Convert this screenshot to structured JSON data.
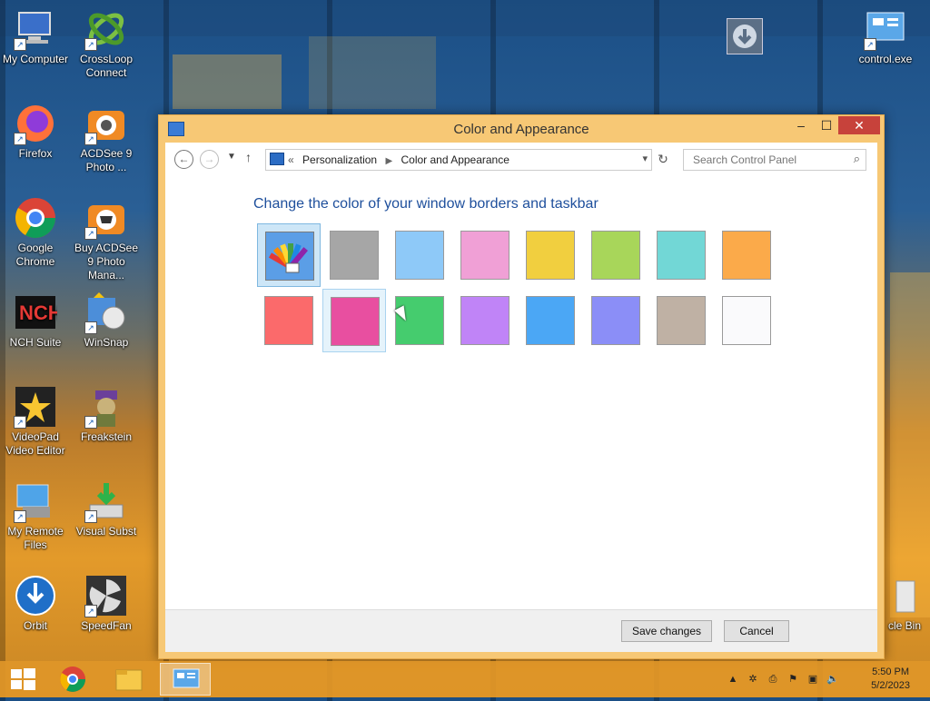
{
  "desktop": {
    "icons": [
      {
        "label": "My Computer",
        "icon": "computer-icon"
      },
      {
        "label": "CrossLoop Connect",
        "icon": "crossloop-icon"
      },
      {
        "label": "Firefox",
        "icon": "firefox-icon"
      },
      {
        "label": "ACDSee 9 Photo ...",
        "icon": "acdsee-icon"
      },
      {
        "label": "Google Chrome",
        "icon": "chrome-icon"
      },
      {
        "label": "Buy ACDSee 9 Photo Mana...",
        "icon": "acdsee-buy-icon"
      },
      {
        "label": "NCH Suite",
        "icon": "nch-icon"
      },
      {
        "label": "WinSnap",
        "icon": "winsnap-icon"
      },
      {
        "label": "VideoPad Video Editor",
        "icon": "videopad-icon"
      },
      {
        "label": "Freakstein",
        "icon": "freakstein-icon"
      },
      {
        "label": "My Remote Files",
        "icon": "remote-files-icon"
      },
      {
        "label": "Visual Subst",
        "icon": "visual-subst-icon"
      },
      {
        "label": "Orbit",
        "icon": "orbit-icon"
      },
      {
        "label": "SpeedFan",
        "icon": "speedfan-icon"
      },
      {
        "label": "control.exe",
        "icon": "control-panel-icon"
      },
      {
        "label": "cle Bin",
        "icon": "recycle-bin-icon"
      }
    ]
  },
  "window": {
    "title": "Color and Appearance",
    "controls": {
      "minimize": "–",
      "maximize": "☐",
      "close": "✕"
    }
  },
  "navigation": {
    "back": "←",
    "forward": "→",
    "up": "↑",
    "refresh": "↻",
    "crumb_prefix": "«",
    "breadcrumbs": [
      "Personalization",
      "Color and Appearance"
    ],
    "search_placeholder": "Search Control Panel"
  },
  "content": {
    "heading": "Change the color of your window borders and taskbar",
    "swatches_row1": [
      "#automatic",
      "#a6a6a6",
      "#8ec9f8",
      "#f0a0d6",
      "#f1cf3f",
      "#a8d65a",
      "#72d7d6",
      "#fbaa4a"
    ],
    "swatches_row2": [
      "#fb6a6b",
      "#e84fa0",
      "#45cc6e",
      "#c084f7",
      "#4ba7f5",
      "#8b8ef7",
      "#bfb1a4",
      "#fafafc"
    ],
    "selected_swatch": "automatic",
    "hover_swatch": "#e84fa0"
  },
  "footer": {
    "save_label": "Save changes",
    "cancel_label": "Cancel"
  },
  "taskbar": {
    "clock_time": "5:50 PM",
    "clock_date": "5/2/2023",
    "items": [
      "chrome-icon",
      "file-explorer-icon",
      "control-panel-icon"
    ]
  }
}
